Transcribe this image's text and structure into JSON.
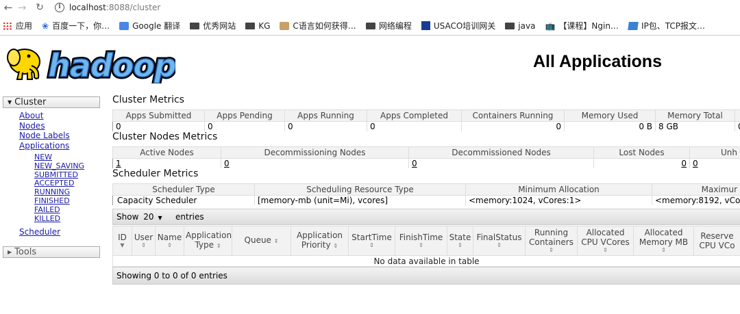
{
  "browser": {
    "url_host": "localhost",
    "url_rest": ":8088/cluster",
    "bookmarks": [
      "应用",
      "百度一下，你…",
      "Google 翻译",
      "优秀网站",
      "KG",
      "C语言如何获得…",
      "网络编程",
      "USACO培训网关",
      "java",
      "【课程】Ngin…",
      "IP包、TCP报文…"
    ]
  },
  "header": {
    "title": "All Applications"
  },
  "nav": {
    "cluster_label": "Cluster",
    "items": [
      "About",
      "Nodes",
      "Node Labels",
      "Applications"
    ],
    "app_states": [
      "NEW",
      "NEW_SAVING",
      "SUBMITTED",
      "ACCEPTED",
      "RUNNING",
      "FINISHED",
      "FAILED",
      "KILLED"
    ],
    "scheduler": "Scheduler",
    "tools_label": "Tools"
  },
  "cluster_metrics": {
    "title": "Cluster Metrics",
    "headers": [
      "Apps Submitted",
      "Apps Pending",
      "Apps Running",
      "Apps Completed",
      "Containers Running",
      "Memory Used",
      "Memory Total",
      ""
    ],
    "values": [
      "0",
      "0",
      "0",
      "0",
      "0",
      "0 B",
      "8 GB",
      "0"
    ]
  },
  "nodes_metrics": {
    "title": "Cluster Nodes Metrics",
    "headers": [
      "Active Nodes",
      "Decommissioning Nodes",
      "Decommissioned Nodes",
      "Lost Nodes",
      "Unh"
    ],
    "values": [
      "1",
      "0",
      "0",
      "0",
      "0"
    ]
  },
  "scheduler_metrics": {
    "title": "Scheduler Metrics",
    "headers": [
      "Scheduler Type",
      "Scheduling Resource Type",
      "Minimum Allocation",
      "Maximur"
    ],
    "values": [
      "Capacity Scheduler",
      "[memory-mb (unit=Mi), vcores]",
      "<memory:1024, vCores:1>",
      "<memory:8192, vCores"
    ]
  },
  "apps_table": {
    "show_label": "Show",
    "page_size": "20",
    "entries_label": "entries",
    "columns": [
      "ID",
      "User",
      "Name",
      "Application Type",
      "Queue",
      "Application Priority",
      "StartTime",
      "FinishTime",
      "State",
      "FinalStatus",
      "Running Containers",
      "Allocated CPU VCores",
      "Allocated Memory MB",
      "Reserve CPU VCo"
    ],
    "empty_message": "No data available in table",
    "footer": "Showing 0 to 0 of 0 entries"
  }
}
